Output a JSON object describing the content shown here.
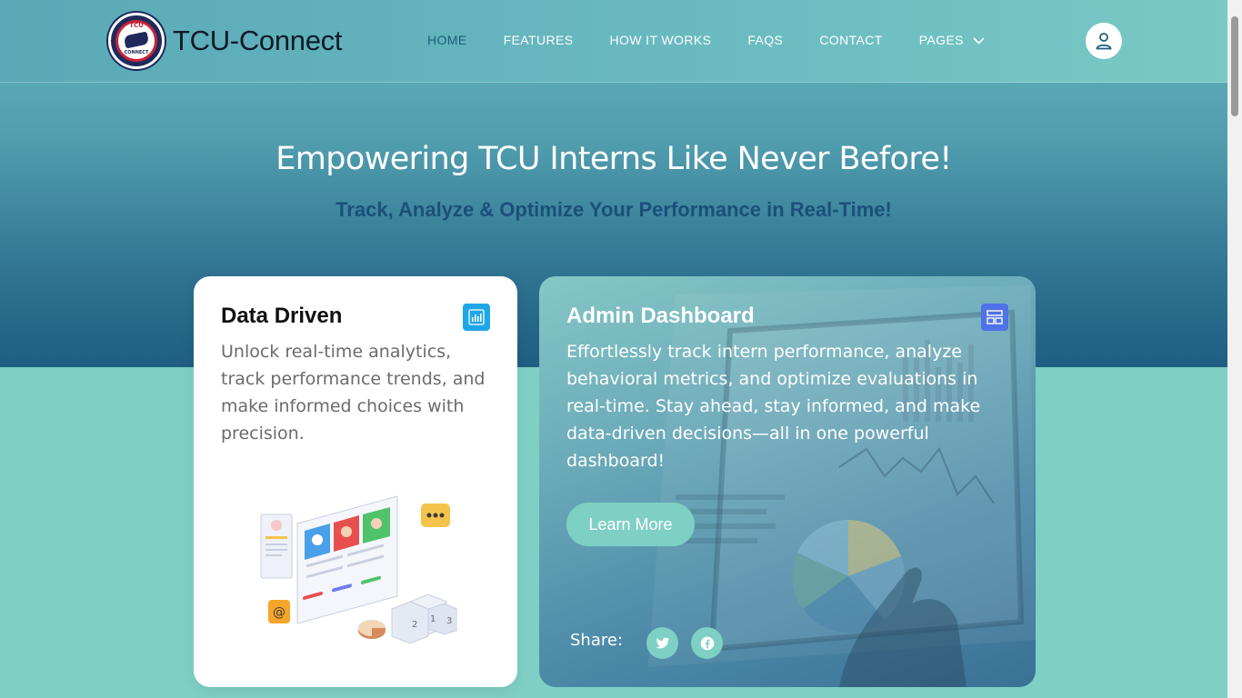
{
  "brand": {
    "name": "TCU-Connect",
    "logo_top": "TCU",
    "logo_bottom": "CONNECT"
  },
  "nav": {
    "items": [
      {
        "label": "HOME",
        "active": true
      },
      {
        "label": "FEATURES",
        "active": false
      },
      {
        "label": "HOW IT WORKS",
        "active": false
      },
      {
        "label": "FAQS",
        "active": false
      },
      {
        "label": "CONTACT",
        "active": false
      },
      {
        "label": "PAGES",
        "active": false,
        "icon": "chevron-down-icon"
      }
    ],
    "user_icon": "user-icon"
  },
  "hero": {
    "title": "Empowering TCU Interns Like Never Before!",
    "subtitle": "Track, Analyze & Optimize Your Performance in Real-Time!"
  },
  "card_data_driven": {
    "title": "Data Driven",
    "icon": "bar-chart-icon",
    "description": "Unlock real-time analytics, track performance trends, and make informed choices with precision."
  },
  "card_admin": {
    "title": "Admin Dashboard",
    "icon": "dashboard-icon",
    "description": "Effortlessly track intern performance, analyze behavioral metrics, and optimize evaluations in real-time. Stay ahead, stay informed, and make data-driven decisions—all in one powerful dashboard!",
    "button_label": "Learn More",
    "share_label": "Share:",
    "social": [
      "twitter-icon",
      "facebook-icon"
    ]
  },
  "colors": {
    "accent": "#7fd0c4",
    "nav_active": "#1d5d7e",
    "subtitle": "#1b4f7a",
    "chart_icon_bg": "#1fa6e8",
    "dashboard_icon_bg": "#4f72e8"
  }
}
